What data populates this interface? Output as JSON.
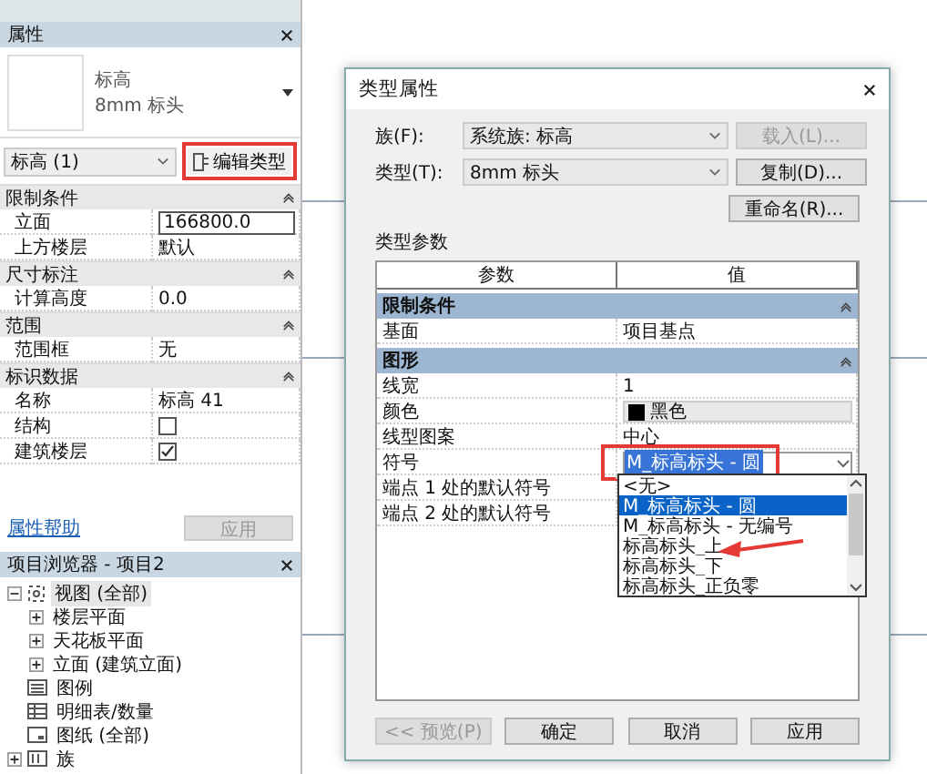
{
  "properties_panel": {
    "title": "属性",
    "type_name": "标高",
    "type_subname": "8mm 标头",
    "instance_selector": "标高 (1)",
    "edit_type_button": {
      "label": "编辑类型",
      "highlighted": true
    },
    "groups": [
      {
        "name": "限制条件",
        "rows": [
          {
            "kind": "input",
            "label": "立面",
            "value": "166800.0"
          },
          {
            "kind": "text",
            "label": "上方楼层",
            "value": "默认"
          }
        ]
      },
      {
        "name": "尺寸标注",
        "rows": [
          {
            "kind": "text",
            "label": "计算高度",
            "value": "0.0"
          }
        ]
      },
      {
        "name": "范围",
        "rows": [
          {
            "kind": "text",
            "label": "范围框",
            "value": "无"
          }
        ]
      },
      {
        "name": "标识数据",
        "rows": [
          {
            "kind": "text",
            "label": "名称",
            "value": "标高 41"
          },
          {
            "kind": "checkbox",
            "label": "结构",
            "checked": false
          },
          {
            "kind": "checkbox",
            "label": "建筑楼层",
            "checked": true
          }
        ]
      }
    ],
    "help_link": "属性帮助",
    "apply_button": {
      "label": "应用",
      "disabled": true
    }
  },
  "project_browser": {
    "title": "项目浏览器 - 项目2",
    "tree": [
      {
        "kind": "views",
        "label": "视图 (全部)",
        "expanded": true,
        "selected": true,
        "children": [
          {
            "label": "楼层平面",
            "expanded": false,
            "selected": false
          },
          {
            "label": "天花板平面",
            "expanded": false,
            "selected": false
          },
          {
            "label": "立面 (建筑立面)",
            "expanded": false,
            "selected": false
          }
        ]
      },
      {
        "kind": "legend",
        "label": "图例",
        "selected": false
      },
      {
        "kind": "schedule",
        "label": "明细表/数量",
        "selected": false
      },
      {
        "kind": "sheet",
        "label": "图纸 (全部)",
        "selected": false
      },
      {
        "kind": "family",
        "label": "族",
        "expanded": false,
        "selected": false
      }
    ]
  },
  "dialog": {
    "title": "类型属性",
    "fields": [
      {
        "label": "族(F):",
        "value": "系统族: 标高",
        "button": {
          "label": "载入(L)...",
          "disabled": true
        }
      },
      {
        "label": "类型(T):",
        "value": "8mm 标头",
        "button": {
          "label": "复制(D)...",
          "disabled": false
        }
      }
    ],
    "rename_button": {
      "label": "重命名(R)...",
      "disabled": false
    },
    "section_label": "类型参数",
    "columns": [
      "参数",
      "值"
    ],
    "groups": [
      {
        "name": "限制条件",
        "rows": [
          {
            "kind": "text",
            "label": "基面",
            "value": "项目基点"
          }
        ]
      },
      {
        "name": "图形",
        "rows": [
          {
            "kind": "text",
            "label": "线宽",
            "value": "1"
          },
          {
            "kind": "color",
            "label": "颜色",
            "value": "黑色",
            "color": "#000000"
          },
          {
            "kind": "text",
            "label": "线型图案",
            "value": "中心"
          },
          {
            "kind": "dropdown",
            "label": "符号",
            "value": "M_标高标头 - 圆",
            "highlighted": true,
            "open": true,
            "options": [
              {
                "label": "<无>",
                "selected": false
              },
              {
                "label": "M_标高标头 - 圆",
                "selected": true
              },
              {
                "label": "M_标高标头 - 无编号",
                "selected": false
              },
              {
                "label": "标高标头_上",
                "selected": false
              },
              {
                "label": "标高标头_下",
                "selected": false
              },
              {
                "label": "标高标头_正负零",
                "selected": false
              }
            ]
          },
          {
            "kind": "text",
            "label": "端点 1 处的默认符号"
          },
          {
            "kind": "text",
            "label": "端点 2 处的默认符号"
          }
        ]
      }
    ],
    "annotation_arrow": true,
    "buttons": [
      {
        "label": "<< 预览(P)",
        "disabled": true
      },
      {
        "label": "确定",
        "disabled": false
      },
      {
        "label": "取消",
        "disabled": false
      },
      {
        "label": "应用",
        "disabled": false
      }
    ]
  }
}
